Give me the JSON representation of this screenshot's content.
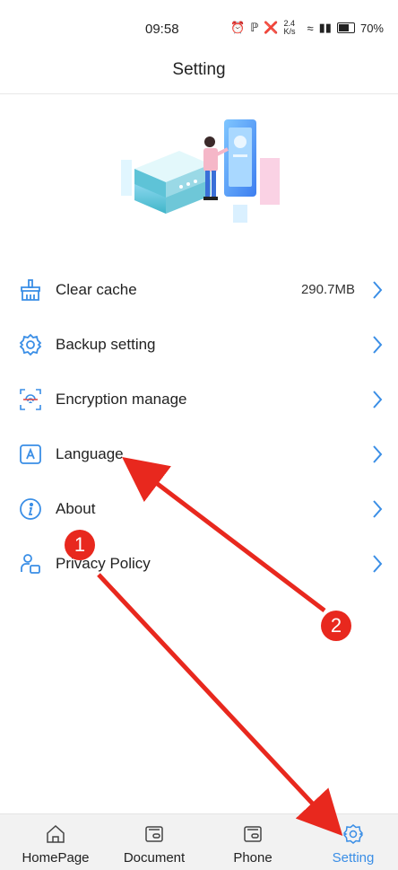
{
  "status_bar": {
    "time": "09:58",
    "net_speed": "2.4 K/s",
    "battery": "70%"
  },
  "header": {
    "title": "Setting"
  },
  "menu": [
    {
      "icon": "broom-icon",
      "label": "Clear cache",
      "value": "290.7MB"
    },
    {
      "icon": "gear-icon",
      "label": "Backup setting"
    },
    {
      "icon": "fingerprint-icon",
      "label": "Encryption manage"
    },
    {
      "icon": "language-icon",
      "label": "Language"
    },
    {
      "icon": "info-icon",
      "label": "About"
    },
    {
      "icon": "privacy-user-icon",
      "label": "Privacy Policy"
    }
  ],
  "tabs": [
    {
      "icon": "home-icon",
      "label": "HomePage"
    },
    {
      "icon": "document-icon",
      "label": "Document"
    },
    {
      "icon": "phone-icon",
      "label": "Phone"
    },
    {
      "icon": "gear-icon",
      "label": "Setting",
      "active": true
    }
  ],
  "annotations": {
    "badge_1": "1",
    "badge_2": "2"
  },
  "colors": {
    "accent": "#3a8ee6",
    "annotation_red": "#e8281e"
  }
}
